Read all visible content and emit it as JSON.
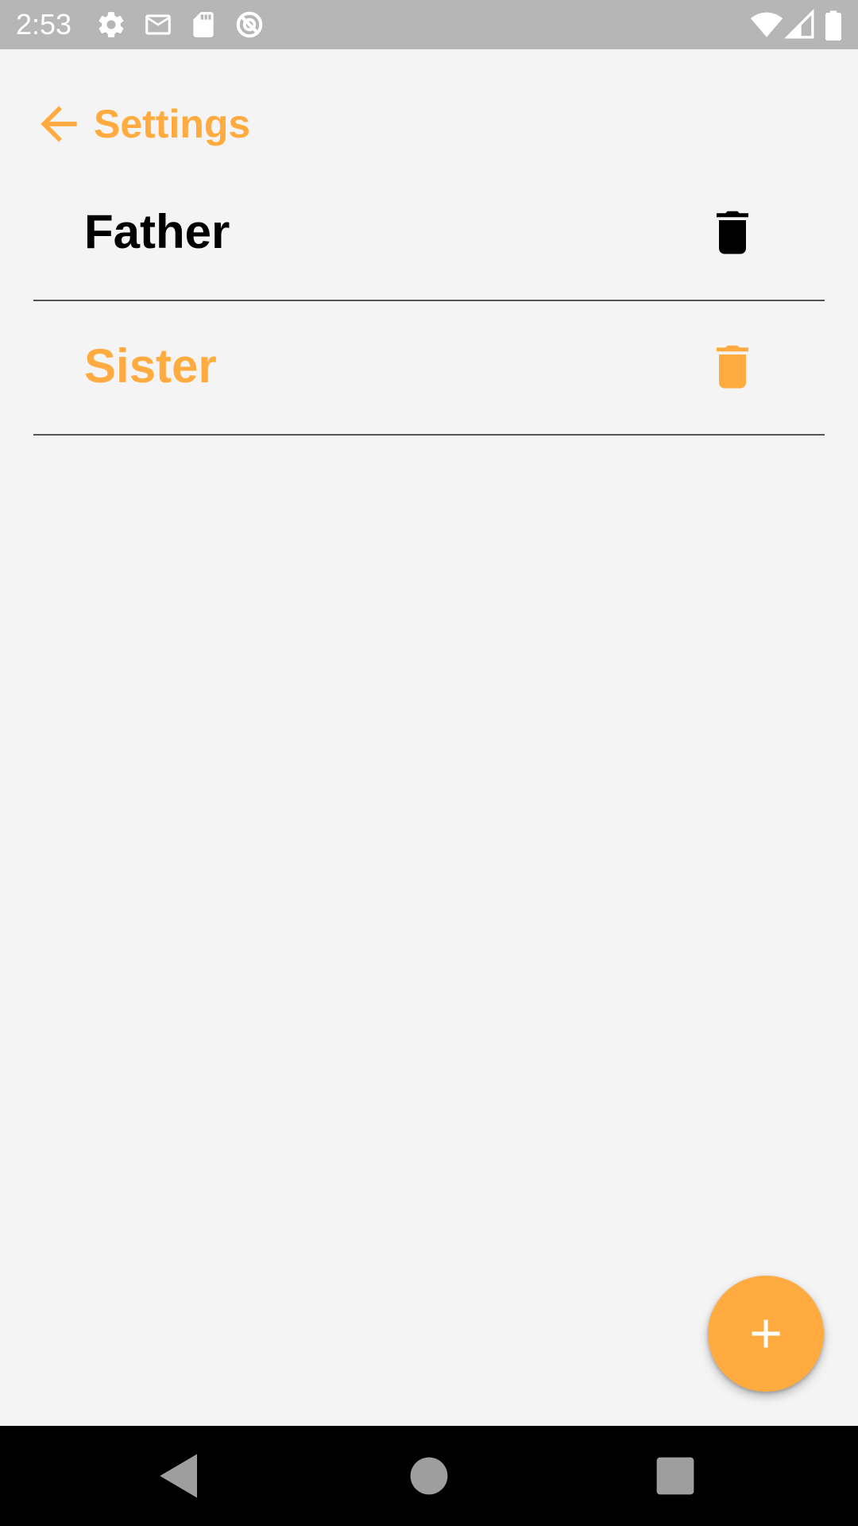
{
  "status_bar": {
    "time": "2:53",
    "left_icons": [
      "gear-icon",
      "mail-icon",
      "sd-card-icon",
      "do-not-disturb-icon"
    ],
    "right_icons": [
      "wifi-icon",
      "cell-signal-icon",
      "battery-icon"
    ]
  },
  "header": {
    "title": "Settings",
    "back_icon": "arrow-back-icon"
  },
  "colors": {
    "accent": "#ffab40",
    "background": "#f4f4f4",
    "text_primary": "#000000",
    "status_bar": "#b6b6b6",
    "divider": "#555555",
    "nav_bar": "#000000"
  },
  "list": {
    "items": [
      {
        "label": "Father",
        "selected": false,
        "action_icon": "trash-icon"
      },
      {
        "label": "Sister",
        "selected": true,
        "action_icon": "trash-icon"
      }
    ]
  },
  "fab": {
    "icon": "plus-icon"
  },
  "nav_bar": {
    "buttons": [
      "back-triangle-icon",
      "home-circle-icon",
      "recents-square-icon"
    ]
  }
}
